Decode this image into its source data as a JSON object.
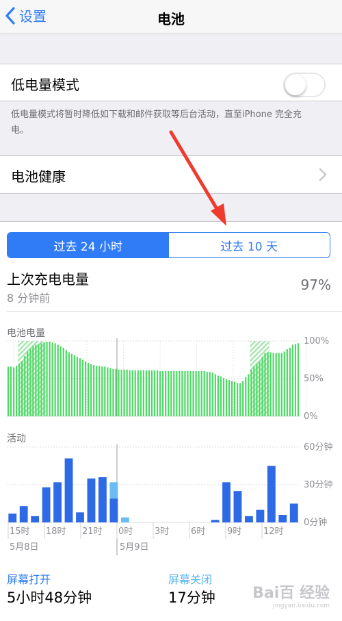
{
  "nav": {
    "back_label": "设置",
    "title": "电池"
  },
  "low_power": {
    "label": "低电量模式",
    "enabled": false,
    "footnote": "低电量模式将暂时降低如下载和邮件获取等后台活动，直至iPhone 完全充电。"
  },
  "battery_health": {
    "label": "电池健康"
  },
  "segment": {
    "tabs": [
      "过去 24 小时",
      "过去 10 天"
    ],
    "selected": 0
  },
  "last_charge": {
    "title": "上次充电电量",
    "time_ago": "8 分钟前",
    "percent": "97%"
  },
  "colors": {
    "accent": "#2f7cf6",
    "battery_green": "#4cd964",
    "charging_hatch": "#a8e6b0",
    "activity_on": "#2f6ae6",
    "activity_off": "#6bbcf5"
  },
  "chart_data": [
    {
      "type": "bar",
      "title": "电池电量",
      "y_tick_labels": [
        "100%",
        "50%",
        "0%"
      ],
      "ylim": [
        0,
        100
      ],
      "values": [
        66,
        66,
        65,
        67,
        70,
        73,
        80,
        86,
        90,
        93,
        95,
        96,
        97,
        98,
        99,
        99,
        98,
        97,
        95,
        93,
        91,
        88,
        85,
        83,
        81,
        79,
        77,
        75,
        73,
        71,
        69,
        68,
        67,
        67,
        66,
        66,
        65,
        64,
        63,
        63,
        62,
        62,
        62,
        62,
        61,
        61,
        61,
        61,
        61,
        61,
        61,
        61,
        61,
        61,
        61,
        60,
        60,
        60,
        60,
        60,
        60,
        60,
        60,
        60,
        60,
        60,
        60,
        60,
        60,
        60,
        60,
        60,
        59,
        59,
        58,
        56,
        54,
        53,
        51,
        49,
        48,
        47,
        46,
        44,
        44,
        47,
        52,
        56,
        62,
        66,
        70,
        73,
        79,
        84,
        85,
        85,
        84,
        84,
        84,
        84,
        86,
        89,
        91,
        95,
        96,
        97
      ],
      "charging_ranges": [
        [
          4,
          13
        ],
        [
          88,
          94
        ]
      ]
    },
    {
      "type": "bar",
      "title": "活动",
      "y_tick_labels": [
        "60分钟",
        "30分钟",
        "0分钟"
      ],
      "ylim": [
        0,
        60
      ],
      "x_tick_labels": [
        "15时",
        "18时",
        "21时",
        "0时",
        "3时",
        "6时",
        "9时",
        "12时"
      ],
      "date_labels": [
        "5月8日",
        "5月9日"
      ],
      "series": [
        {
          "name": "屏幕打开",
          "values": [
            7,
            13,
            5,
            28,
            32,
            51,
            8,
            35,
            36,
            19,
            0,
            0,
            0,
            0,
            0,
            0,
            0,
            0,
            2,
            32,
            25,
            5,
            10,
            45,
            6,
            15
          ]
        },
        {
          "name": "屏幕关闭",
          "values": [
            0,
            0,
            0,
            0,
            0,
            0,
            0,
            0,
            0,
            13,
            4,
            0,
            0,
            0,
            0,
            0,
            0,
            0,
            0,
            0,
            0,
            0,
            0,
            0,
            0,
            0
          ]
        }
      ]
    }
  ],
  "summary": {
    "screen_on_label": "屏幕打开",
    "screen_on_value": "5小时48分钟",
    "screen_off_label": "屏幕关闭",
    "screen_off_value": "17分钟"
  },
  "watermark": {
    "brand": "Bai百 经验",
    "url": "jingyan.baidu.com"
  }
}
